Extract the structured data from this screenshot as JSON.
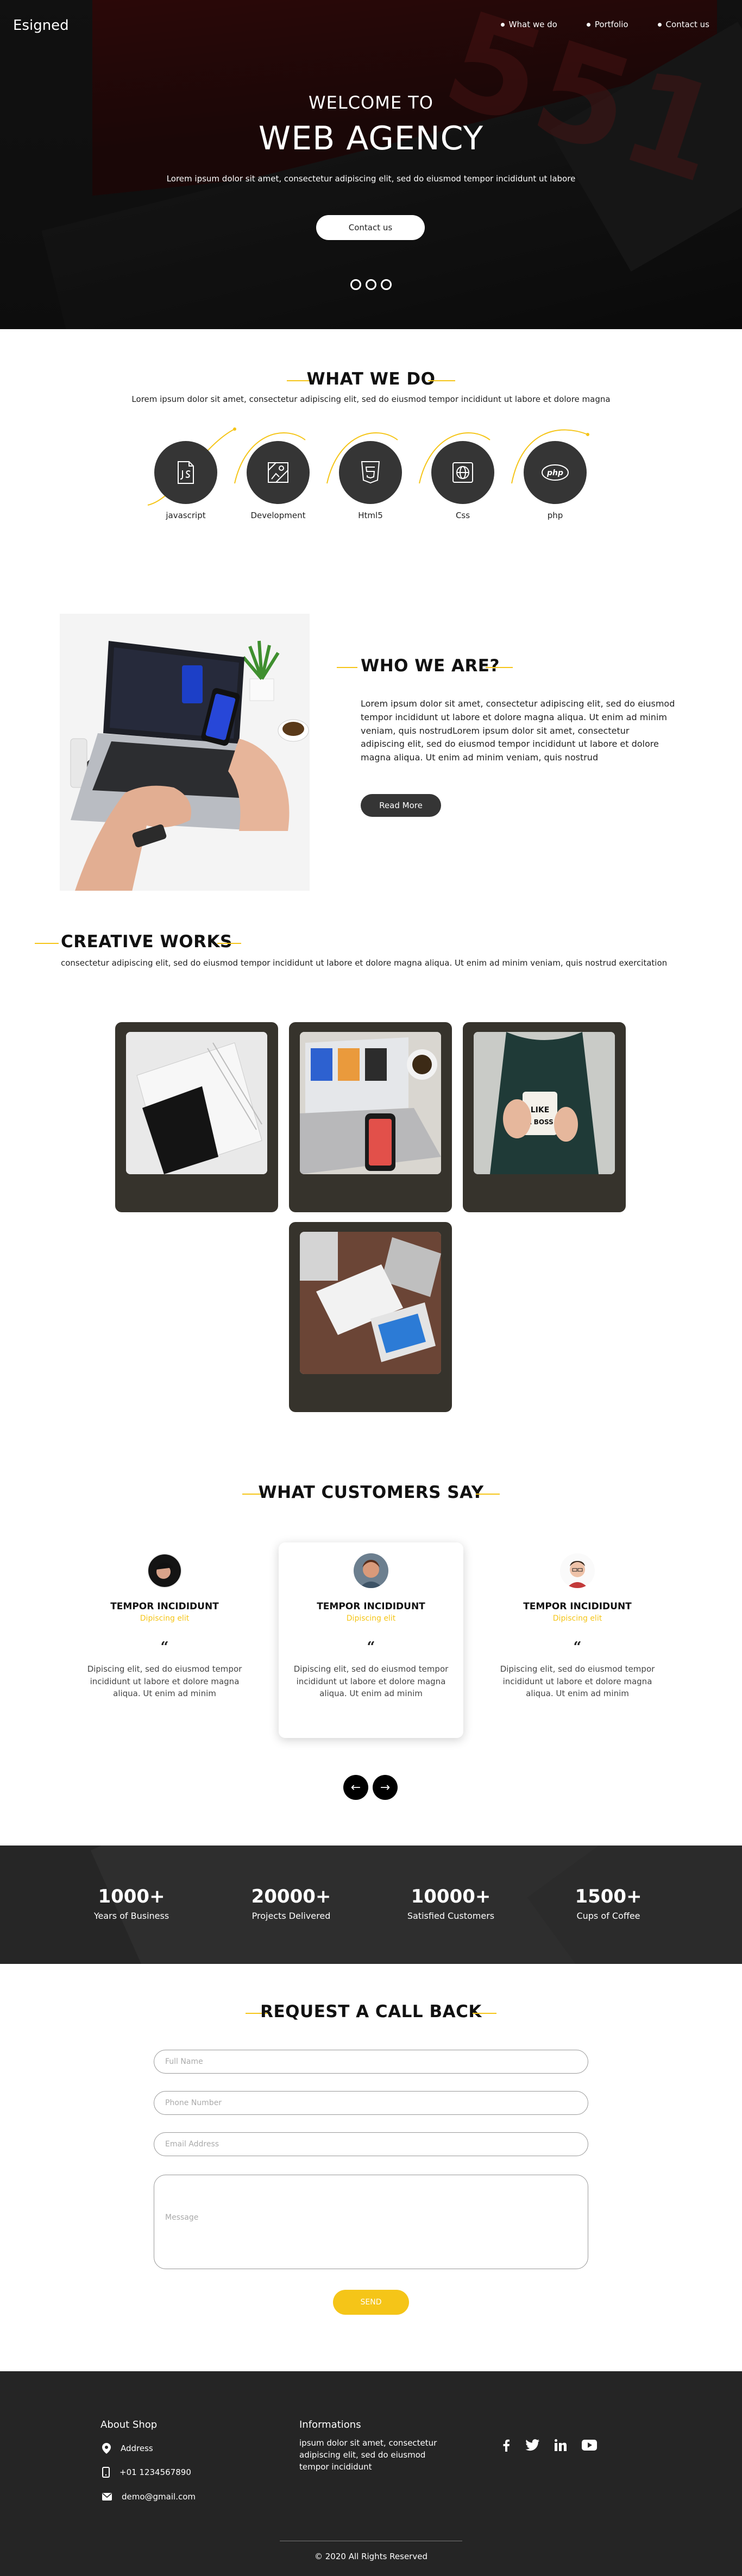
{
  "nav": {
    "brand": "Esigned",
    "links": [
      "What we do",
      "Portfolio",
      "Contact us"
    ]
  },
  "hero": {
    "welcome": "WELCOME TO",
    "title": "WEB AGENCY",
    "subtitle": "Lorem ipsum dolor sit amet, consectetur adipiscing elit, sed do eiusmod tempor incididunt ut labore",
    "button": "Contact us",
    "slides": 3,
    "active_slide": 1
  },
  "what_we_do": {
    "title": "WHAT WE DO",
    "subtitle": "Lorem ipsum dolor sit amet, consectetur adipiscing elit, sed do eiusmod tempor incididunt ut labore et dolore magna",
    "skills": [
      {
        "label": "javascript",
        "icon": "js-file-icon"
      },
      {
        "label": "Development",
        "icon": "development-icon"
      },
      {
        "label": "Html5",
        "icon": "html5-icon"
      },
      {
        "label": "Css",
        "icon": "globe-icon"
      },
      {
        "label": "php",
        "icon": "php-icon"
      }
    ]
  },
  "who_we_are": {
    "title": "WHO WE ARE?",
    "text": "Lorem ipsum dolor sit amet, consectetur adipiscing elit, sed do eiusmod tempor incididunt ut labore et dolore magna aliqua. Ut enim ad minim veniam, quis nostrudLorem ipsum dolor sit amet, consectetur adipiscing elit, sed do eiusmod tempor incididunt ut labore et dolore magna aliqua. Ut enim ad minim veniam, quis nostrud",
    "button": "Read More"
  },
  "creative_works": {
    "title": "CREATIVE WORKS",
    "text": "consectetur adipiscing elit, sed do eiusmod tempor incididunt ut labore et dolore magna aliqua. Ut enim ad minim veniam, quis nostrud exercitation"
  },
  "customers": {
    "title": "WHAT CUSTOMERS SAY",
    "items": [
      {
        "name": "TEMPOR INCIDIDUNT",
        "role": "Dipiscing elit",
        "text": "Dipiscing elit, sed do eiusmod tempor incididunt ut labore et dolore magna aliqua. Ut enim ad minim"
      },
      {
        "name": "TEMPOR INCIDIDUNT",
        "role": "Dipiscing elit",
        "text": "Dipiscing elit, sed do eiusmod tempor incididunt ut labore et dolore magna aliqua. Ut enim ad minim"
      },
      {
        "name": "TEMPOR INCIDIDUNT",
        "role": "Dipiscing elit",
        "text": "Dipiscing elit, sed do eiusmod tempor incididunt ut labore et dolore magna aliqua. Ut enim ad minim"
      }
    ],
    "quote_mark": "“",
    "prev": "←",
    "next": "→"
  },
  "stats": [
    {
      "value": "1000+",
      "label": "Years of Business"
    },
    {
      "value": "20000+",
      "label": "Projects Delivered"
    },
    {
      "value": "10000+",
      "label": "Satisfied Customers"
    },
    {
      "value": "1500+",
      "label": "Cups of Coffee"
    }
  ],
  "callback": {
    "title": "REQUEST A CALL BACK",
    "placeholders": {
      "name": "Full Name",
      "phone": "Phone Number",
      "email": "Email Address",
      "message": "Message"
    },
    "button": "SEND"
  },
  "footer": {
    "about_title": "About Shop",
    "address": "Address",
    "phone": "+01 1234567890",
    "email": "demo@gmail.com",
    "info_title": "Informations",
    "info_text": "ipsum dolor sit amet, consectetur adipiscing elit, sed do eiusmod tempor incididunt",
    "social": [
      "facebook-icon",
      "twitter-icon",
      "linkedin-icon",
      "youtube-icon"
    ],
    "copyright": "© 2020 All Rights Reserved"
  },
  "colors": {
    "accent": "#f5c518",
    "dark": "#353535",
    "card": "#36332c",
    "footer": "#252525"
  }
}
